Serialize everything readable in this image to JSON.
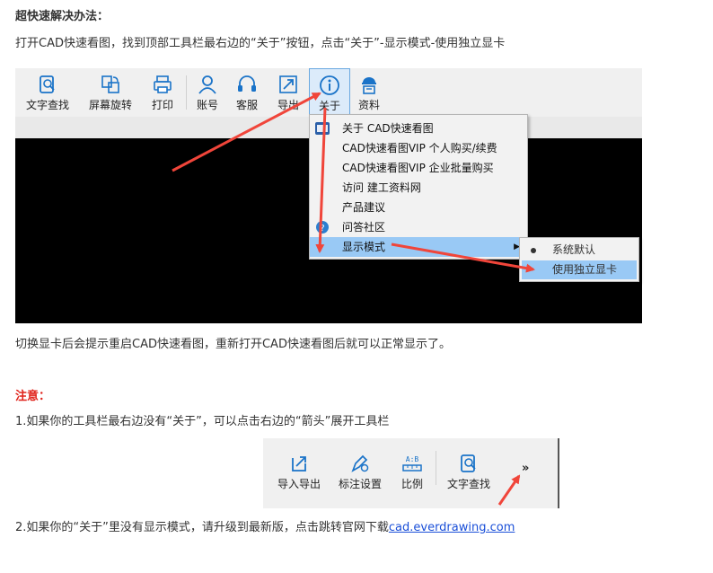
{
  "heading": "超快速解决办法：",
  "step1": "打开CAD快速看图，找到顶部工具栏最右边的“关于”按钮，点击“关于”-显示模式-使用独立显卡",
  "toolbar1": {
    "buttons": [
      "文字查找",
      "屏幕旋转",
      "打印",
      "账号",
      "客服",
      "导出",
      "关于",
      "资料"
    ]
  },
  "menu": {
    "items": [
      "关于 CAD快速看图",
      "CAD快速看图VIP 个人购买/续费",
      "CAD快速看图VIP 企业批量购买",
      "访问 建工资料网",
      "产品建议",
      "问答社区",
      "显示模式"
    ]
  },
  "submenu": {
    "items": [
      "系统默认",
      "使用独立显卡"
    ]
  },
  "after_switch": "切换显卡后会提示重启CAD快速看图，重新打开CAD快速看图后就可以正常显示了。",
  "note_title": "注意：",
  "note1": "1.如果你的工具栏最右边没有“关于”，可以点击右边的“箭头”展开工具栏",
  "toolbar2": {
    "buttons": [
      "导入导出",
      "标注设置",
      "比例",
      "文字查找"
    ],
    "expand": "»"
  },
  "note2": "2.如果你的“关于”里没有显示模式，请升级到最新版，点击跳转官网下载",
  "link_text": "cad.everdrawing.com",
  "colors": {
    "accent": "#1a4fd8",
    "warn": "#e0231b",
    "highlight": "#99c9f5",
    "arrow": "#f0453a"
  }
}
